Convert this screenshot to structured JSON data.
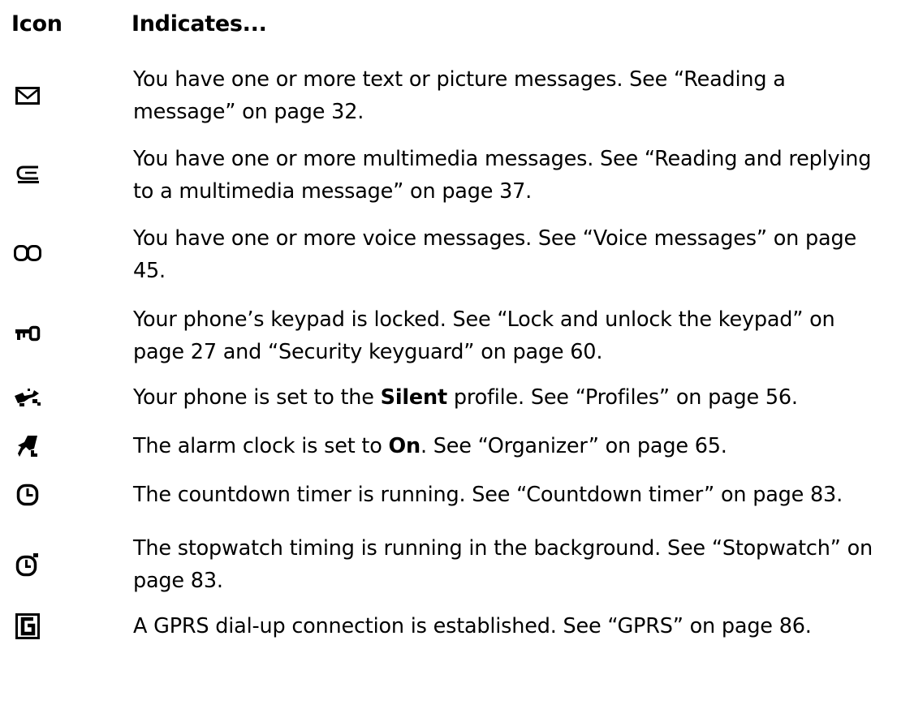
{
  "header": {
    "icon": "Icon",
    "indicates": "Indicates..."
  },
  "rows": [
    {
      "icon": "envelope-icon",
      "pre": "You have one or more text or picture messages. See “Reading a message” on page 32."
    },
    {
      "icon": "multimedia-message-icon",
      "pre": "You have one or more multimedia messages. See “Reading and replying to a multimedia message” on page 37."
    },
    {
      "icon": "voicemail-icon",
      "pre": "You have one or more voice messages. See “Voice messages” on page 45."
    },
    {
      "icon": "key-icon",
      "pre": "Your phone’s keypad is locked. See “Lock and unlock the keypad” on page 27 and “Security keyguard” on page 60."
    },
    {
      "icon": "silent-profile-icon",
      "pre": "Your phone is set to the ",
      "bold": "Silent",
      "post": " profile. See “Profiles” on page 56."
    },
    {
      "icon": "alarm-clock-icon",
      "pre": "The alarm clock is set to ",
      "bold": "On",
      "post": ". See “Organizer” on page 65."
    },
    {
      "icon": "countdown-timer-icon",
      "pre": "The countdown timer is running. See “Countdown timer” on page 83."
    },
    {
      "icon": "stopwatch-icon",
      "pre": "The stopwatch timing is running in the background. See “Stopwatch” on page 83."
    },
    {
      "icon": "gprs-icon",
      "pre": "A GPRS dial-up connection is established. See “GPRS” on page 86."
    }
  ]
}
